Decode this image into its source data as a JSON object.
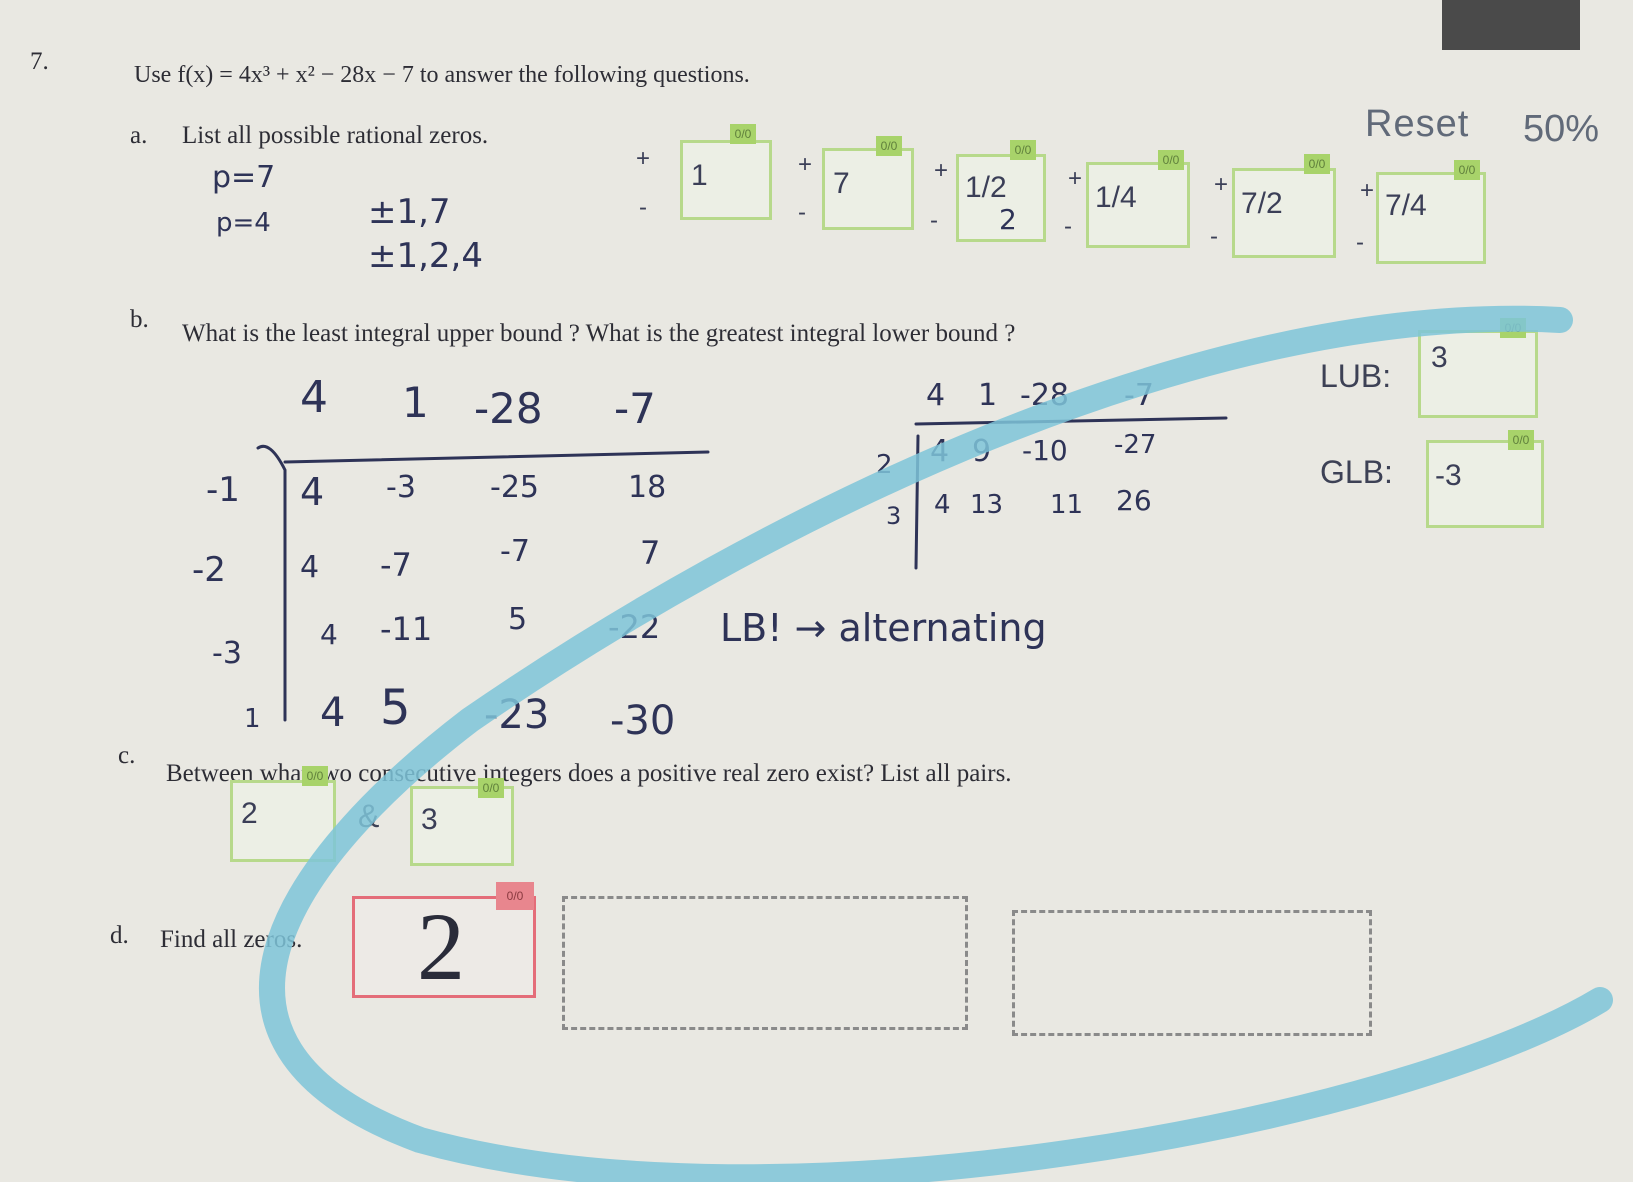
{
  "header": {
    "reset_label": "Reset",
    "score": "50%"
  },
  "question": {
    "number": "7.",
    "prompt": "Use f(x) = 4x³ + x² − 28x − 7 to answer the following questions."
  },
  "part_a": {
    "label": "a.",
    "text": "List all possible rational zeros.",
    "notes": [
      "p=7",
      "p=4",
      "±1,7",
      "±1,2,4"
    ],
    "answers": [
      {
        "value": "1",
        "extra": "",
        "score": "0/0"
      },
      {
        "value": "7",
        "extra": "",
        "score": "0/0"
      },
      {
        "value": "1/2",
        "extra": "2",
        "score": "0/0"
      },
      {
        "value": "1/4",
        "extra": "",
        "score": "0/0"
      },
      {
        "value": "7/2",
        "extra": "",
        "score": "0/0"
      },
      {
        "value": "7/4",
        "extra": "",
        "score": "0/0"
      }
    ],
    "plus": "+",
    "minus": "-"
  },
  "part_b": {
    "label": "b.",
    "text": "What is the least integral upper bound ?   What is the greatest integral lower bound ?",
    "lub_label": "LUB:",
    "lub_value": "3",
    "lub_score": "0/0",
    "glb_label": "GLB:",
    "glb_value": "-3",
    "glb_score": "0/0",
    "left_work": {
      "coeffs": [
        "4",
        "1",
        "-28",
        "-7"
      ],
      "rows": [
        {
          "r": "-1",
          "vals": [
            "4",
            "-3",
            "-25",
            "18"
          ]
        },
        {
          "r": "-2",
          "vals": [
            "4",
            "-7",
            "-7",
            "7"
          ]
        },
        {
          "r": "-3",
          "vals": [
            "4",
            "-11",
            "5",
            "-22"
          ]
        },
        {
          "r": "1",
          "vals": [
            "4",
            "5",
            "-23",
            "-30"
          ]
        }
      ],
      "note": "LB! → alternating"
    },
    "right_work": {
      "coeffs": [
        "4",
        "1",
        "-28",
        "-7"
      ],
      "rows": [
        {
          "r": "2",
          "vals": [
            "4",
            "9",
            "-10",
            "-27"
          ]
        },
        {
          "r": "3",
          "vals": [
            "4",
            "13",
            "11",
            "26"
          ]
        }
      ]
    }
  },
  "part_c": {
    "label": "c.",
    "text": "Between what two consecutive integers does a positive real zero exist?  List all pairs.",
    "first": "2",
    "first_score": "0/0",
    "amp": "&",
    "second": "3",
    "second_score": "0/0"
  },
  "part_d": {
    "label": "d.",
    "text": "Find all zeros.",
    "answer": "2",
    "answer_score": "0/0"
  }
}
